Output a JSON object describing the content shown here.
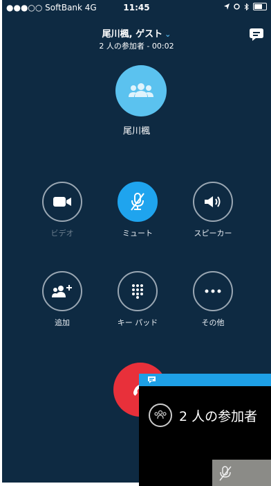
{
  "status_bar": {
    "carrier": "●●●○○ SoftBank  4G",
    "time": "11:45"
  },
  "header": {
    "title": "尾川楓, ゲスト",
    "subtitle": "2 人の参加者 - 00:02"
  },
  "callee": {
    "name": "尾川楓"
  },
  "controls": [
    {
      "label": "ビデオ",
      "icon": "video-camera-icon",
      "active": false,
      "disabled": true
    },
    {
      "label": "ミュート",
      "icon": "microphone-muted-icon",
      "active": true,
      "disabled": false
    },
    {
      "label": "スピーカー",
      "icon": "speaker-icon",
      "active": false,
      "disabled": false
    },
    {
      "label": "追加",
      "icon": "add-participant-icon",
      "active": false,
      "disabled": false
    },
    {
      "label": "キー パッド",
      "icon": "keypad-icon",
      "active": false,
      "disabled": false
    },
    {
      "label": "その他",
      "icon": "more-icon",
      "active": false,
      "disabled": false
    }
  ],
  "overlay": {
    "participants_text": "2 人の参加者"
  },
  "colors": {
    "background": "#0e2a42",
    "accent": "#1fa4ee",
    "avatar": "#5bc2ef",
    "hangup": "#e8303a"
  }
}
